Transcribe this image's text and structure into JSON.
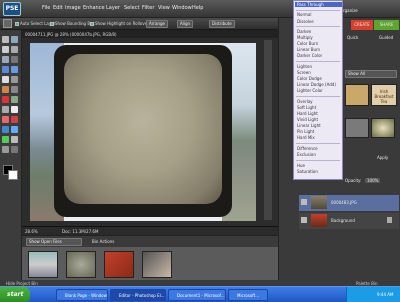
{
  "menubar": {
    "items": [
      "File",
      "Edit",
      "Image",
      "Enhance",
      "Layer",
      "Select",
      "Filter",
      "View",
      "Window",
      "Help"
    ],
    "right_label": "rganize",
    "tabs": [
      "EDIT",
      "CREATE",
      "SHARE"
    ]
  },
  "options_bar": {
    "auto_select_layer": "Auto Select Layer",
    "show_bounding_box": "Show Bounding Box",
    "show_highlight": "Show Highlight on Rollover",
    "arrange": "Arrange",
    "align": "Align",
    "distribute": "Distribute"
  },
  "document": {
    "title": "00004711.JPG @ 28% (0000047b.JPG, RGB/8)",
    "zoom": "28.6%",
    "doc_info": "Doc: 11.3M/27.6M"
  },
  "blend_menu": {
    "selected": "Pass Through",
    "groups": [
      [
        "Normal",
        "Dissolve"
      ],
      [
        "Darken",
        "Multiply",
        "Color Burn",
        "Linear Burn",
        "Darker Color"
      ],
      [
        "Lighten",
        "Screen",
        "Color Dodge",
        "Linear Dodge (Add)",
        "Lighter Color"
      ],
      [
        "Overlay",
        "Soft Light",
        "Hard Light",
        "Vivid Light",
        "Linear Light",
        "Pin Light",
        "Hard Mix"
      ],
      [
        "Difference",
        "Exclusion"
      ],
      [
        "Hue",
        "Saturation"
      ]
    ]
  },
  "right_panel": {
    "quick_tab": "Quick",
    "guided_tab": "Guided",
    "show_all": "Show All",
    "effect_label": "Irish Breakfast Tea",
    "apply": "Apply",
    "opacity_label": "Opacity:",
    "opacity_value": "100%",
    "layers": [
      {
        "name": "0000483.JPG"
      },
      {
        "name": "Background"
      }
    ]
  },
  "bin": {
    "show_label": "Show Open Files",
    "actions_label": "Bin Actions",
    "hide_label": "Hide Project Bin",
    "palette_bin": "Palette Bin"
  },
  "taskbar": {
    "start": "start",
    "tasks": [
      "Blank Page - Window...",
      "Editor - Photoshop El...",
      "Document1 - Microsof...",
      "Microsoft..."
    ],
    "time": "9:44 AM"
  },
  "colors": {
    "accent": "#4a66c8",
    "taskbar": "#2a62d6",
    "start": "#3aa030"
  }
}
